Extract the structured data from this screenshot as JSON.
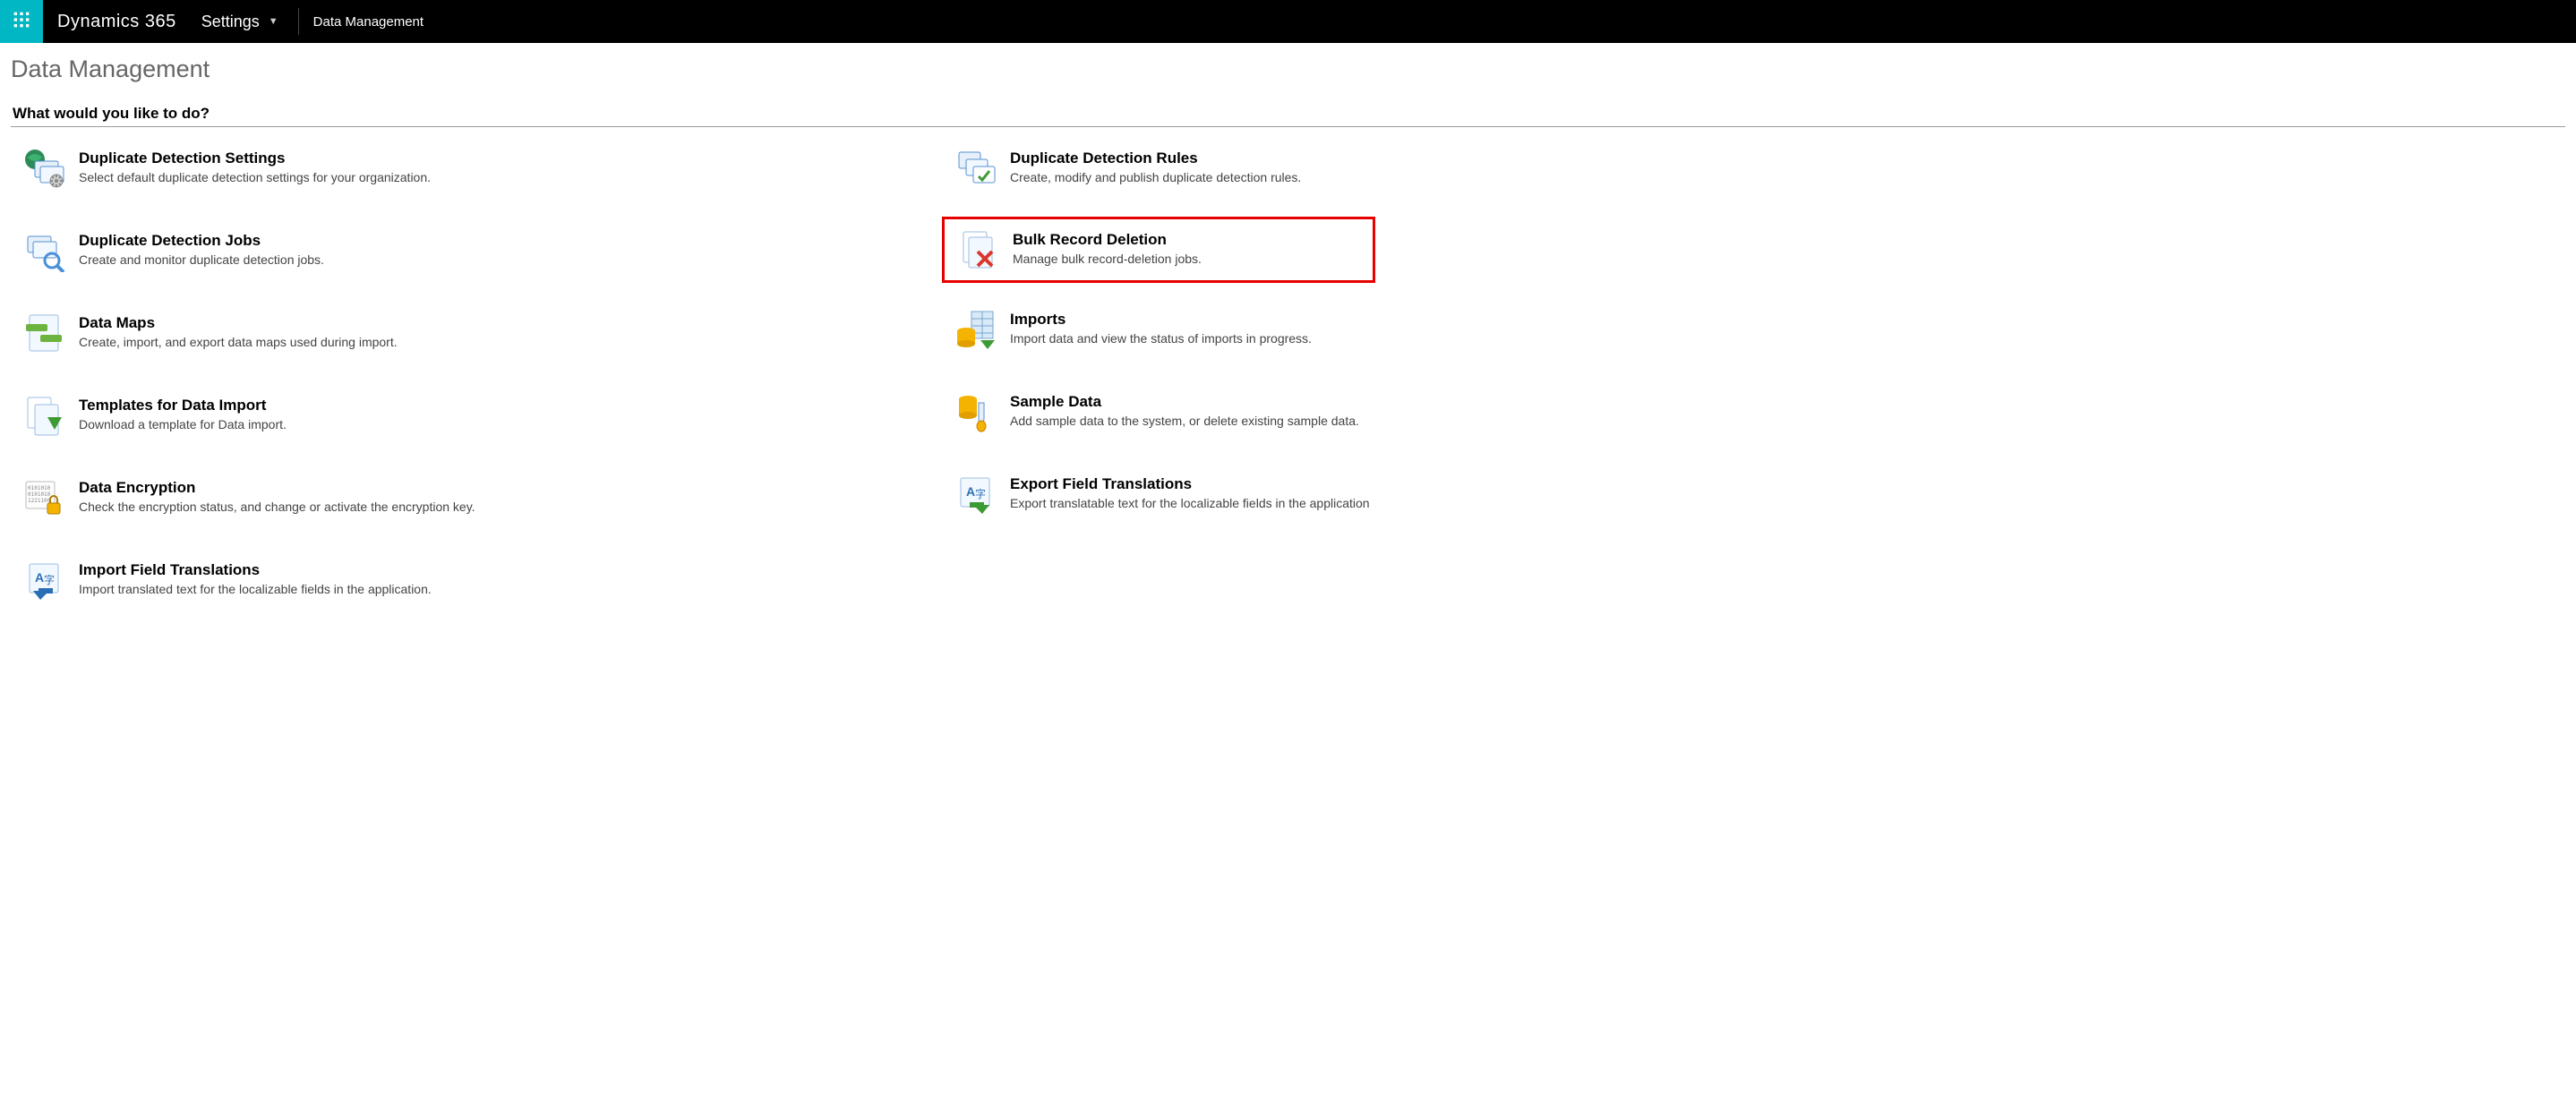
{
  "header": {
    "brand": "Dynamics 365",
    "settings_label": "Settings",
    "breadcrumb": "Data Management"
  },
  "page": {
    "title": "Data Management",
    "prompt": "What would you like to do?"
  },
  "left": [
    {
      "title": "Duplicate Detection Settings",
      "desc": "Select default duplicate detection settings for your organization."
    },
    {
      "title": "Duplicate Detection Jobs",
      "desc": "Create and monitor duplicate detection jobs."
    },
    {
      "title": "Data Maps",
      "desc": "Create, import, and export data maps used during import."
    },
    {
      "title": "Templates for Data Import",
      "desc": "Download a template for Data import."
    },
    {
      "title": "Data Encryption",
      "desc": "Check the encryption status, and change or activate the encryption key."
    },
    {
      "title": "Import Field Translations",
      "desc": "Import translated text for the localizable fields in the application."
    }
  ],
  "right": [
    {
      "title": "Duplicate Detection Rules",
      "desc": "Create, modify and publish duplicate detection rules."
    },
    {
      "title": "Bulk Record Deletion",
      "desc": "Manage bulk record-deletion jobs."
    },
    {
      "title": "Imports",
      "desc": "Import data and view the status of imports in progress."
    },
    {
      "title": "Sample Data",
      "desc": "Add sample data to the system, or delete existing sample data."
    },
    {
      "title": "Export Field Translations",
      "desc": "Export translatable text for the localizable fields in the application"
    }
  ]
}
